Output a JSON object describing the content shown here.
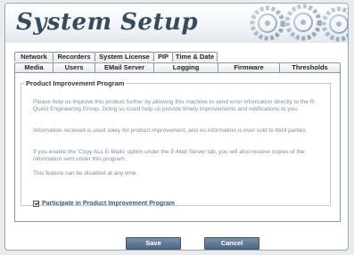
{
  "header": {
    "title": "System Setup"
  },
  "tabs": {
    "row1": [
      {
        "label": "Network"
      },
      {
        "label": "Recorders"
      },
      {
        "label": "System License"
      },
      {
        "label": "PIP",
        "active": true
      },
      {
        "label": "Time & Date"
      }
    ],
    "row2": [
      {
        "label": "Media"
      },
      {
        "label": "Users"
      },
      {
        "label": "EMail Server"
      },
      {
        "label": "Logging"
      },
      {
        "label": "Firmware"
      },
      {
        "label": "Thresholds"
      }
    ]
  },
  "section": {
    "legend": "Product Improvement Program",
    "paragraphs": [
      "Please help us improve this product further by allowing this machine to send error information directly to the R-Quest Engineering Group.  Doing so could help us provide timely improvements and notifications to you.",
      "Information received is used soley for product improvement, and no information is ever sold to third parties.",
      "If you enable the 'Copy ALL E-Mails' option under the E-Mail Server tab, you will also receive copies of the information sent under this program.",
      "This feature can be disabled at any time."
    ],
    "checkbox": {
      "label": "Participate in Product Improvement Program",
      "checked": true
    }
  },
  "buttons": {
    "save": "Save",
    "cancel": "Cancel"
  },
  "colors": {
    "title": "#394a5c",
    "body_text": "#7b8fa3",
    "button": "#5d7591",
    "border": "#8b97a3"
  }
}
